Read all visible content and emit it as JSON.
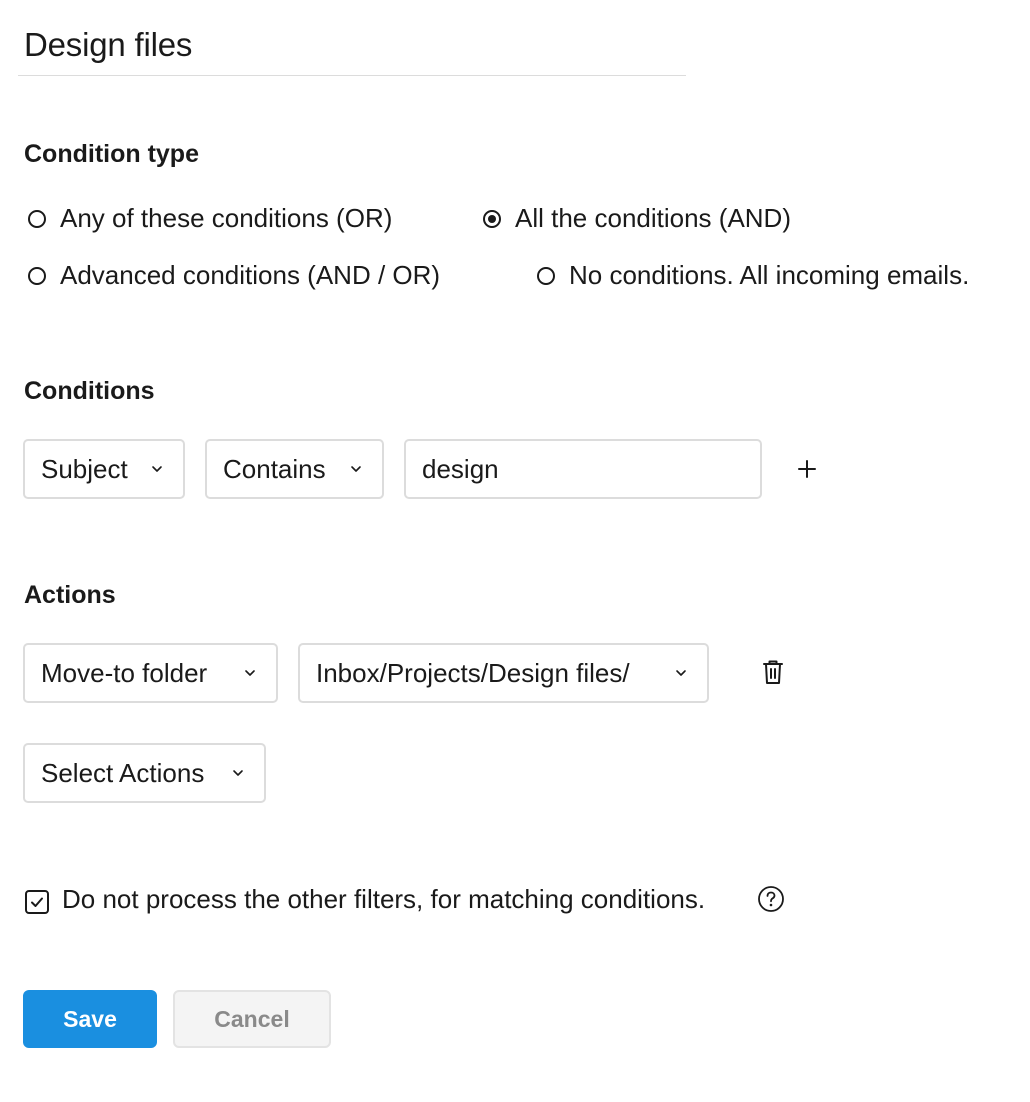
{
  "filter": {
    "name": "Design files"
  },
  "condition_type": {
    "heading": "Condition type",
    "options": [
      {
        "label": "Any of these conditions (OR)",
        "checked": false
      },
      {
        "label": "All the conditions (AND)",
        "checked": true
      },
      {
        "label": "Advanced conditions (AND / OR)",
        "checked": false
      },
      {
        "label": "No conditions. All incoming emails.",
        "checked": false
      }
    ]
  },
  "conditions": {
    "heading": "Conditions",
    "rows": [
      {
        "field": "Subject",
        "operator": "Contains",
        "value": "design"
      }
    ],
    "add_icon": "plus-icon"
  },
  "actions": {
    "heading": "Actions",
    "rows": [
      {
        "action": "Move-to folder",
        "target": "Inbox/Projects/Design files/"
      }
    ],
    "delete_icon": "trash-icon",
    "select_placeholder": "Select Actions"
  },
  "stop_processing": {
    "label": "Do not process the other filters, for matching conditions.",
    "checked": true,
    "help_icon": "question-circle-icon"
  },
  "buttons": {
    "save": "Save",
    "cancel": "Cancel"
  },
  "colors": {
    "primary": "#1a8fe0",
    "border": "#dcdcdc",
    "text": "#1a1a1a"
  }
}
